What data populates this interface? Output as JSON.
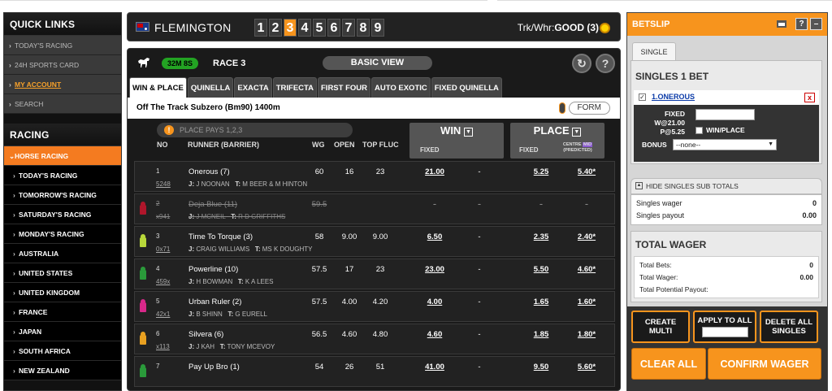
{
  "quick_links": {
    "title": "QUICK LINKS",
    "items": [
      {
        "label": "TODAY'S RACING"
      },
      {
        "label": "24H SPORTS CARD"
      },
      {
        "label": "MY ACCOUNT"
      },
      {
        "label": "SEARCH"
      }
    ]
  },
  "racing_menu": {
    "title": "RACING",
    "items": [
      {
        "label": "HORSE RACING",
        "active": true
      },
      {
        "label": "TODAY'S RACING"
      },
      {
        "label": "TOMORROW'S RACING"
      },
      {
        "label": "SATURDAY'S RACING"
      },
      {
        "label": "MONDAY'S RACING"
      },
      {
        "label": "AUSTRALIA"
      },
      {
        "label": "UNITED STATES"
      },
      {
        "label": "UNITED KINGDOM"
      },
      {
        "label": "FRANCE"
      },
      {
        "label": "JAPAN"
      },
      {
        "label": "SOUTH AFRICA"
      },
      {
        "label": "NEW ZEALAND"
      }
    ]
  },
  "venue_bar": {
    "venue": "FLEMINGTON",
    "race_numbers": [
      "1",
      "2",
      "3",
      "4",
      "5",
      "6",
      "7",
      "8",
      "9"
    ],
    "selected_race": "3",
    "track_weather_label": "Trk/Whr:",
    "track_weather_value": "GOOD (3)"
  },
  "race": {
    "countdown": "32M 8S",
    "race_label": "RACE 3",
    "view_button": "BASIC VIEW",
    "refresh_icon": "refresh-icon",
    "help_label": "?",
    "tabs": [
      "WIN & PLACE",
      "QUINELLA",
      "EXACTA",
      "TRIFECTA",
      "FIRST FOUR",
      "AUTO EXOTIC",
      "FIXED QUINELLA"
    ],
    "selected_tab": "WIN & PLACE",
    "title": "Off The Track Subzero (Bm90) 1400m",
    "form_button": "FORM",
    "place_pays": "PLACE PAYS 1,2,3"
  },
  "columns": {
    "no": "NO",
    "runner": "RUNNER (BARRIER)",
    "wg": "WG",
    "open": "OPEN",
    "top_fluc": "TOP FLUC",
    "win": "WIN",
    "win_fixed": "FIXED",
    "place": "PLACE",
    "place_fixed": "FIXED",
    "centre_label": "CENTRE",
    "centre_mid": "MID",
    "centre_sub": "(PREDICTED)"
  },
  "runners": [
    {
      "no": "1",
      "form": "5248",
      "name": "Onerous (7)",
      "jockey": "J NOONAN",
      "trainer": "M BEER & M HINTON",
      "wg": "60",
      "open": "16",
      "fluc": "23",
      "win_fixed": "21.00",
      "win_tote": "-",
      "place_fixed": "5.25",
      "place_tote": "5.40*",
      "scratched": false,
      "silk_color": "#222222"
    },
    {
      "no": "2",
      "form": "x941",
      "name": "Deja Blue (11)",
      "jockey": "J MCNEIL",
      "trainer": "R D GRIFFITHS",
      "wg": "59.5",
      "open": "",
      "fluc": "",
      "win_fixed": "-",
      "win_tote": "-",
      "place_fixed": "-",
      "place_tote": "-",
      "scratched": true,
      "silk_color": "#b0162b"
    },
    {
      "no": "3",
      "form": "0x71",
      "name": "Time To Torque (3)",
      "jockey": "CRAIG WILLIAMS",
      "trainer": "MS K DOUGHTY",
      "wg": "58",
      "open": "9.00",
      "fluc": "9.00",
      "win_fixed": "6.50",
      "win_tote": "-",
      "place_fixed": "2.35",
      "place_tote": "2.40*",
      "scratched": false,
      "silk_color": "#b8d83a"
    },
    {
      "no": "4",
      "form": "459x",
      "name": "Powerline (10)",
      "jockey": "H BOWMAN",
      "trainer": "K A LEES",
      "wg": "57.5",
      "open": "17",
      "fluc": "23",
      "win_fixed": "23.00",
      "win_tote": "-",
      "place_fixed": "5.50",
      "place_tote": "4.60*",
      "scratched": false,
      "silk_color": "#2a9a3a"
    },
    {
      "no": "5",
      "form": "42x1",
      "name": "Urban Ruler (2)",
      "jockey": "B SHINN",
      "trainer": "G EURELL",
      "wg": "57.5",
      "open": "4.00",
      "fluc": "4.20",
      "win_fixed": "4.00",
      "win_tote": "-",
      "place_fixed": "1.65",
      "place_tote": "1.60*",
      "scratched": false,
      "silk_color": "#d8288a"
    },
    {
      "no": "6",
      "form": "x113",
      "name": "Silvera (6)",
      "jockey": "J KAH",
      "trainer": "TONY MCEVOY",
      "wg": "56.5",
      "open": "4.60",
      "fluc": "4.80",
      "win_fixed": "4.60",
      "win_tote": "-",
      "place_fixed": "1.85",
      "place_tote": "1.80*",
      "scratched": false,
      "silk_color": "#e8a020"
    },
    {
      "no": "7",
      "form": "",
      "name": "Pay Up Bro (1)",
      "jockey": "",
      "trainer": "",
      "wg": "54",
      "open": "26",
      "fluc": "51",
      "win_fixed": "41.00",
      "win_tote": "-",
      "place_fixed": "9.50",
      "place_tote": "5.60*",
      "scratched": false,
      "silk_color": "#2a9a3a"
    }
  ],
  "betslip": {
    "title": "BETSLIP",
    "help_label": "?",
    "minimize_label": "–",
    "single_tab": "SINGLE",
    "singles_title": "SINGLES 1 BET",
    "selection_name": "1.ONEROUS",
    "remove_label": "x",
    "fixed_label": "FIXED",
    "win_price": "W@21.00",
    "place_price": "P@5.25",
    "win_place_label": "WIN/PLACE",
    "bonus_label": "BONUS",
    "bonus_value": "--none--",
    "hide_subtotals": "HIDE SINGLES SUB TOTALS",
    "singles_wager_label": "Singles wager",
    "singles_wager_value": "0",
    "singles_payout_label": "Singles payout",
    "singles_payout_value": "0.00",
    "total_wager_title": "TOTAL WAGER",
    "total_bets_label": "Total Bets:",
    "total_bets_value": "0",
    "total_wager_label": "Total Wager:",
    "total_wager_value": "0.00",
    "total_payout_label": "Total Potential Payout:",
    "create_multi": "CREATE MULTI",
    "apply_to_all": "APPLY TO ALL",
    "delete_all": "DELETE ALL SINGLES",
    "clear_all": "CLEAR ALL",
    "confirm_wager": "CONFIRM WAGER"
  },
  "colors": {
    "accent": "#f7941d",
    "timer": "#23a323",
    "sidebar_active": "#f47b20"
  }
}
